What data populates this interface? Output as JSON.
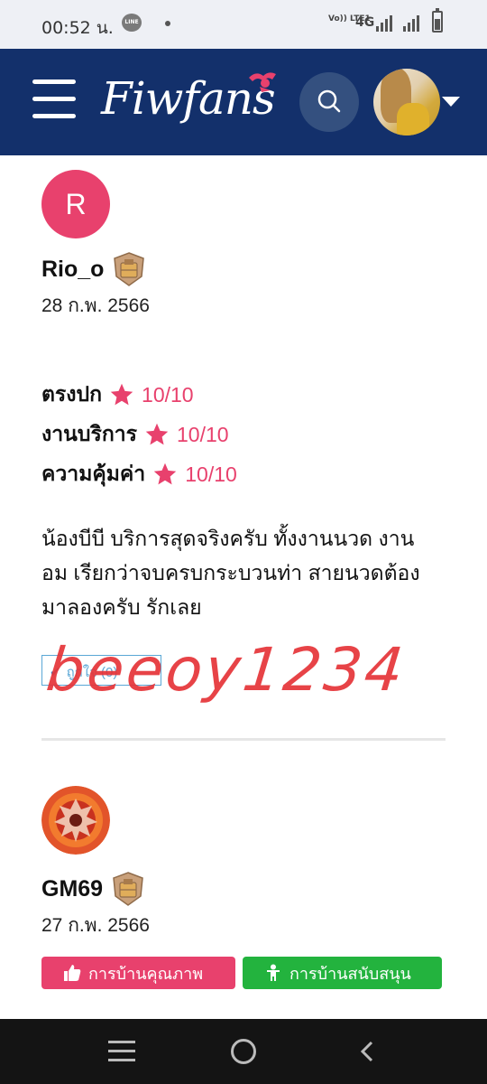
{
  "status_bar": {
    "time": "00:52 น.",
    "line_icon": "LINE",
    "volte": "Vo)) LTE1",
    "network": "4G"
  },
  "header": {
    "logo_text": "Fiwfans",
    "icons": [
      "menu-icon",
      "search-icon",
      "chevron-down-icon"
    ]
  },
  "reviews": [
    {
      "avatar_letter": "R",
      "name": "Rio_o",
      "date": "28 ก.พ. 2566",
      "ratings": [
        {
          "label": "ตรงปก",
          "value": "10/10"
        },
        {
          "label": "งานบริการ",
          "value": "10/10"
        },
        {
          "label": "ความคุ้มค่า",
          "value": "10/10"
        }
      ],
      "text": "น้องบีบี บริการสุดจริงครับ ทั้งงานนวด งานอม เรียกว่าจบครบกระบวนท่า สายนวดต้องมาลองครับ รักเลย",
      "like_label": "ถูกใจ (0)"
    },
    {
      "name": "GM69",
      "date": "27 ก.พ. 2566",
      "tags": [
        "การบ้านคุณภาพ",
        "การบ้านสนับสนุน"
      ]
    }
  ],
  "watermark": "beeoy1234",
  "colors": {
    "navbar": "#13306b",
    "accent_pink": "#e8416d",
    "accent_green": "#23b33e",
    "watermark": "#e53438"
  }
}
